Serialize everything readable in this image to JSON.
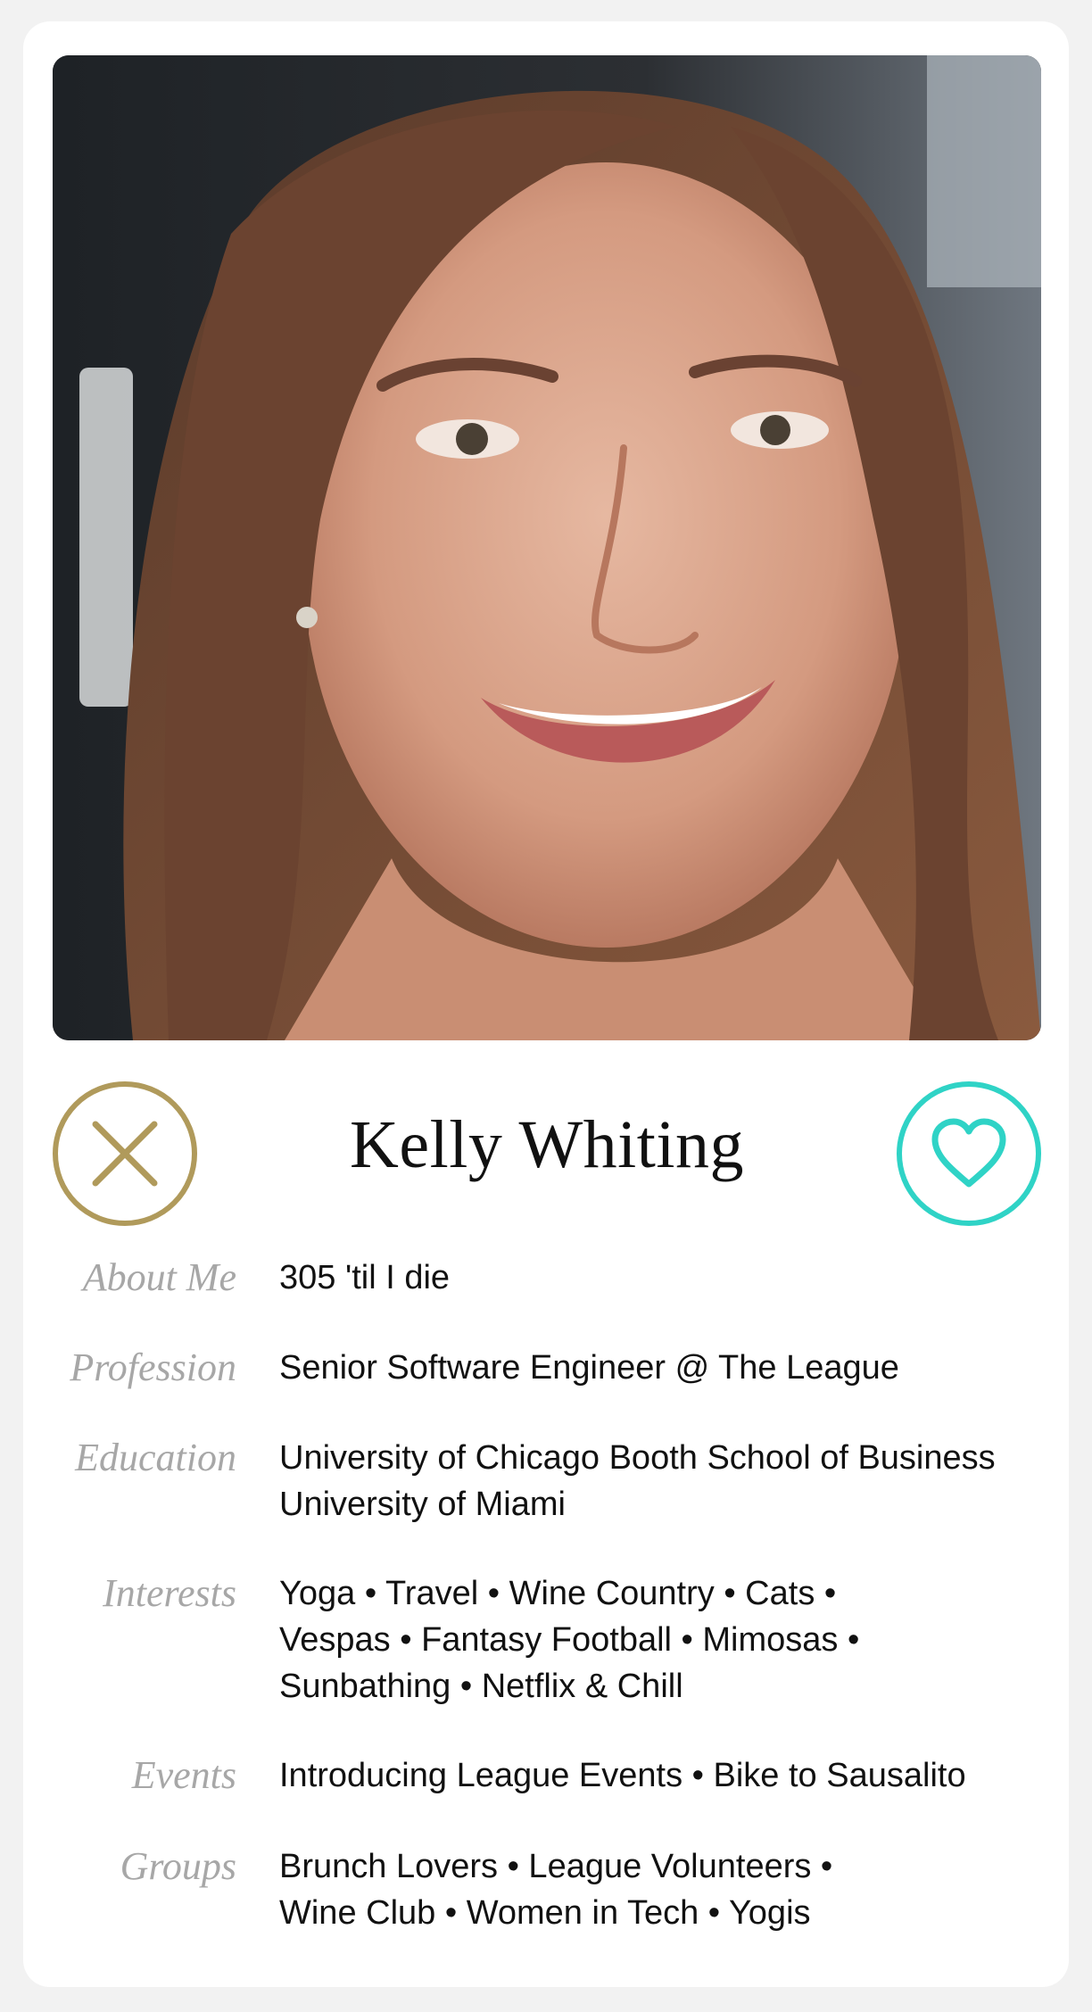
{
  "profile": {
    "name": "Kelly Whiting"
  },
  "actions": {
    "pass_icon": "close-icon",
    "like_icon": "heart-icon",
    "pass_color": "#b09a5b",
    "like_color": "#2fd3c6"
  },
  "details": {
    "about_me": {
      "label": "About Me",
      "lines": [
        "305 'til I die"
      ]
    },
    "profession": {
      "label": "Profession",
      "lines": [
        "Senior Software Engineer @ The League"
      ]
    },
    "education": {
      "label": "Education",
      "lines": [
        "University of Chicago Booth School of Business",
        "University of Miami"
      ]
    },
    "interests": {
      "label": "Interests",
      "lines": [
        "Yoga • Travel • Wine Country • Cats •",
        "Vespas • Fantasy Football • Mimosas •",
        "Sunbathing • Netflix & Chill"
      ]
    },
    "events": {
      "label": "Events",
      "lines": [
        "Introducing League Events • Bike to Sausalito"
      ]
    },
    "groups": {
      "label": "Groups",
      "lines": [
        "Brunch Lovers • League Volunteers •",
        "Wine Club • Women in Tech • Yogis"
      ]
    }
  }
}
